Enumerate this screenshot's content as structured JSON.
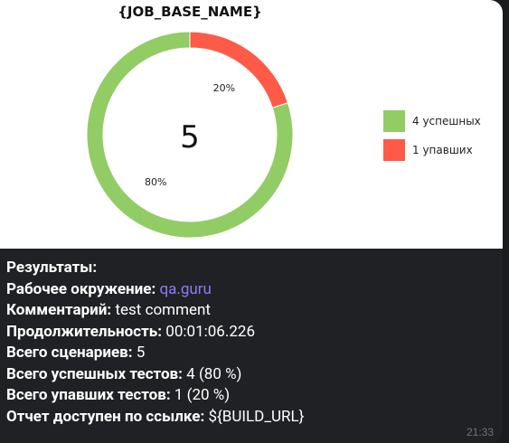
{
  "colors": {
    "passed": "#92cc65",
    "failed": "#fe5a48",
    "link": "#8b7cf6",
    "bubble_bg": "#1f2124"
  },
  "chart_data": {
    "type": "pie",
    "title": "{JOB_BASE_NAME}",
    "center_label": "5",
    "slices": [
      {
        "name": "4 успешных",
        "value": 80,
        "label": "80%",
        "color": "#92cc65"
      },
      {
        "name": "1 упавших",
        "value": 20,
        "label": "20%",
        "color": "#fe5a48"
      }
    ],
    "legend_position": "right"
  },
  "message": {
    "results_title": "Результаты:",
    "environment_key": "Рабочее окружение:",
    "environment_value": "qa.guru",
    "comment_key": "Комментарий:",
    "comment_value": "test comment",
    "duration_key": "Продолжительность:",
    "duration_value": "00:01:06.226",
    "scenarios_key": "Всего сценариев:",
    "scenarios_value": "5",
    "passed_key": "Всего успешных тестов:",
    "passed_value": "4 (80 %)",
    "failed_key": "Всего упавших тестов:",
    "failed_value": "1 (20 %)",
    "report_key": "Отчет доступен по ссылке:",
    "report_value": "${BUILD_URL}",
    "time": "21:33"
  }
}
